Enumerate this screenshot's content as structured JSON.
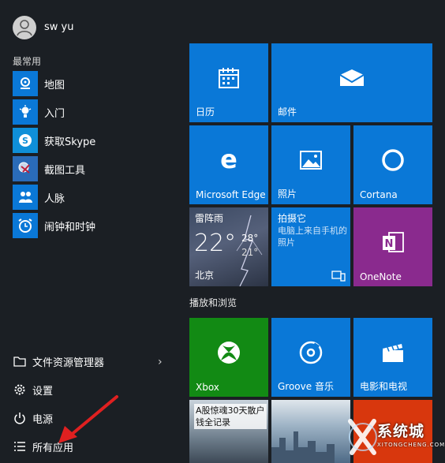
{
  "user": {
    "name": "sw yu"
  },
  "most_used": {
    "label": "最常用",
    "items": [
      {
        "label": "地图",
        "icon": "map-icon"
      },
      {
        "label": "入门",
        "icon": "lightbulb-icon"
      },
      {
        "label": "获取Skype",
        "icon": "skype-icon"
      },
      {
        "label": "截图工具",
        "icon": "snipping-tool-icon"
      },
      {
        "label": "人脉",
        "icon": "people-icon"
      },
      {
        "label": "闹钟和时钟",
        "icon": "alarm-clock-icon"
      }
    ]
  },
  "system": {
    "file_explorer": "文件资源管理器",
    "settings": "设置",
    "power": "电源",
    "all_apps": "所有应用"
  },
  "tiles": {
    "calendar": "日历",
    "mail": "邮件",
    "edge": "Microsoft Edge",
    "photos": "照片",
    "cortana": "Cortana",
    "weather": {
      "condition": "雷阵雨",
      "temp": "22°",
      "high": "28°",
      "low": "21°",
      "city": "北京"
    },
    "phone_photos": {
      "title": "拍摄它",
      "desc": "电脑上来自手机的照片"
    },
    "onenote": "OneNote"
  },
  "group2": {
    "label": "播放和浏览",
    "xbox": "Xbox",
    "groove": "Groove 音乐",
    "movies": "电影和电视",
    "news": "A股惊魂30天散户钱全记录"
  },
  "watermark": {
    "text": "系统城",
    "sub": "XITONGCHENG.COM"
  },
  "colors": {
    "tile_blue": "#0a78d7",
    "tile_green": "#128a14",
    "tile_purple": "#8a2a8e",
    "background": "#1b1f24",
    "annotation_red": "#e02020"
  }
}
